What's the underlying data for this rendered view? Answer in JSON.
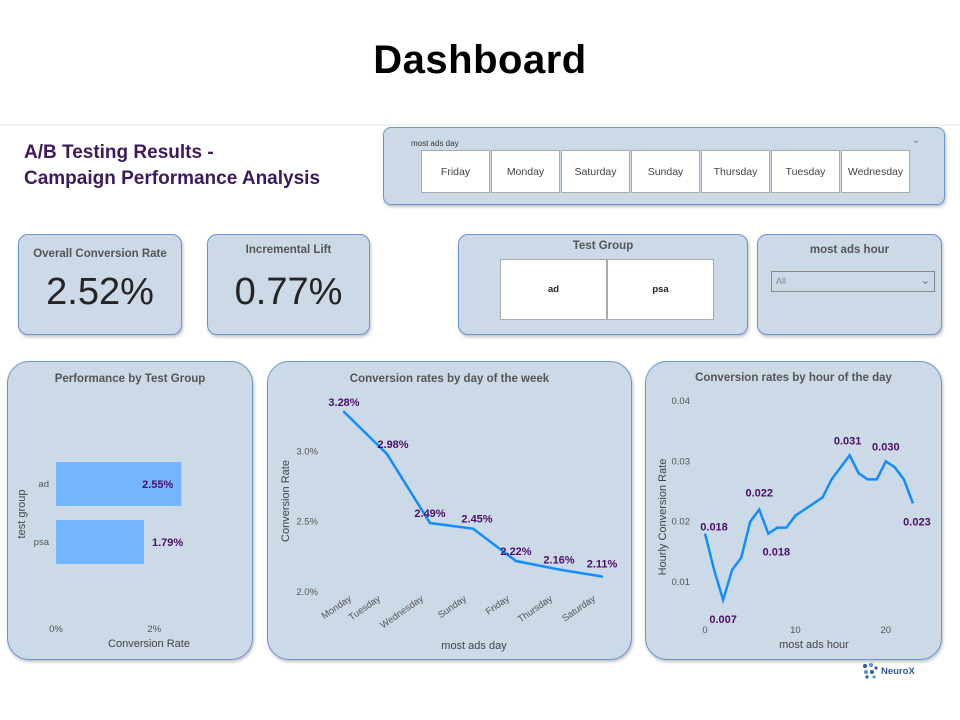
{
  "slide": {
    "title": "Dashboard"
  },
  "report": {
    "title_line1": "A/B Testing Results -",
    "title_line2": "Campaign Performance Analysis"
  },
  "day_slicer": {
    "label": "most ads day",
    "options": [
      "Friday",
      "Monday",
      "Saturday",
      "Sunday",
      "Thursday",
      "Tuesday",
      "Wednesday"
    ]
  },
  "kpis": {
    "conversion": {
      "label": "Overall Conversion Rate",
      "value": "2.52%"
    },
    "lift": {
      "label": "Incremental Lift",
      "value": "0.77%"
    }
  },
  "test_group_slicer": {
    "label": "Test Group",
    "options": [
      "ad",
      "psa"
    ]
  },
  "hour_slicer": {
    "label": "most ads hour",
    "selected": "All"
  },
  "brand": {
    "logo_text": "NeuroX"
  },
  "colors": {
    "bar": "#74b5ff",
    "line": "#118dff",
    "label": "#4b0e6b",
    "card_bg": "#ccd9e6",
    "card_border": "#6a94d4"
  },
  "chart_data": [
    {
      "type": "bar",
      "title": "Performance by Test Group",
      "categories": [
        "ad",
        "psa"
      ],
      "values": [
        2.55,
        1.79
      ],
      "data_labels": [
        "2.55%",
        "1.79%"
      ],
      "xlabel": "Conversion Rate",
      "ylabel": "test group",
      "xlim": [
        0,
        3.5
      ],
      "x_ticks": [
        "0%",
        "2%"
      ],
      "x_tick_values": [
        0,
        2
      ]
    },
    {
      "type": "line",
      "title": "Conversion rates by day of the week",
      "categories": [
        "Monday",
        "Tuesday",
        "Wednesday",
        "Sunday",
        "Friday",
        "Thursday",
        "Saturday"
      ],
      "values": [
        3.28,
        2.98,
        2.49,
        2.45,
        2.22,
        2.16,
        2.11
      ],
      "data_labels": [
        "3.28%",
        "2.98%",
        "2.49%",
        "2.45%",
        "2.22%",
        "2.16%",
        "2.11%"
      ],
      "xlabel": "most ads day",
      "ylabel": "Conversion Rate",
      "ylim": [
        2.0,
        3.35
      ],
      "y_ticks": [
        "2.0%",
        "2.5%",
        "3.0%"
      ],
      "y_tick_values": [
        2.0,
        2.5,
        3.0
      ]
    },
    {
      "type": "line",
      "title": "Conversion rates by hour of the day",
      "x": [
        0,
        1,
        2,
        3,
        4,
        5,
        6,
        7,
        8,
        9,
        10,
        11,
        12,
        13,
        14,
        15,
        16,
        17,
        18,
        19,
        20,
        21,
        22,
        23
      ],
      "values": [
        0.018,
        0.012,
        0.007,
        0.012,
        0.014,
        0.02,
        0.022,
        0.018,
        0.019,
        0.019,
        0.021,
        0.022,
        0.023,
        0.024,
        0.027,
        0.029,
        0.031,
        0.028,
        0.027,
        0.027,
        0.03,
        0.029,
        0.027,
        0.023
      ],
      "labeled_points": [
        {
          "index": 0,
          "text": "0.018"
        },
        {
          "index": 2,
          "text": "0.007"
        },
        {
          "index": 6,
          "text": "0.022"
        },
        {
          "index": 7,
          "text": "0.018"
        },
        {
          "index": 16,
          "text": "0.031"
        },
        {
          "index": 20,
          "text": "0.030"
        },
        {
          "index": 23,
          "text": "0.023"
        }
      ],
      "xlabel": "most ads hour",
      "ylabel": "Hourly Conversion Rate",
      "xlim": [
        -1,
        25
      ],
      "ylim": [
        0.005,
        0.04
      ],
      "x_ticks": [
        "0",
        "10",
        "20"
      ],
      "x_tick_values": [
        0,
        10,
        20
      ],
      "y_ticks": [
        "0.01",
        "0.02",
        "0.03",
        "0.04"
      ],
      "y_tick_values": [
        0.01,
        0.02,
        0.03,
        0.04
      ]
    }
  ]
}
